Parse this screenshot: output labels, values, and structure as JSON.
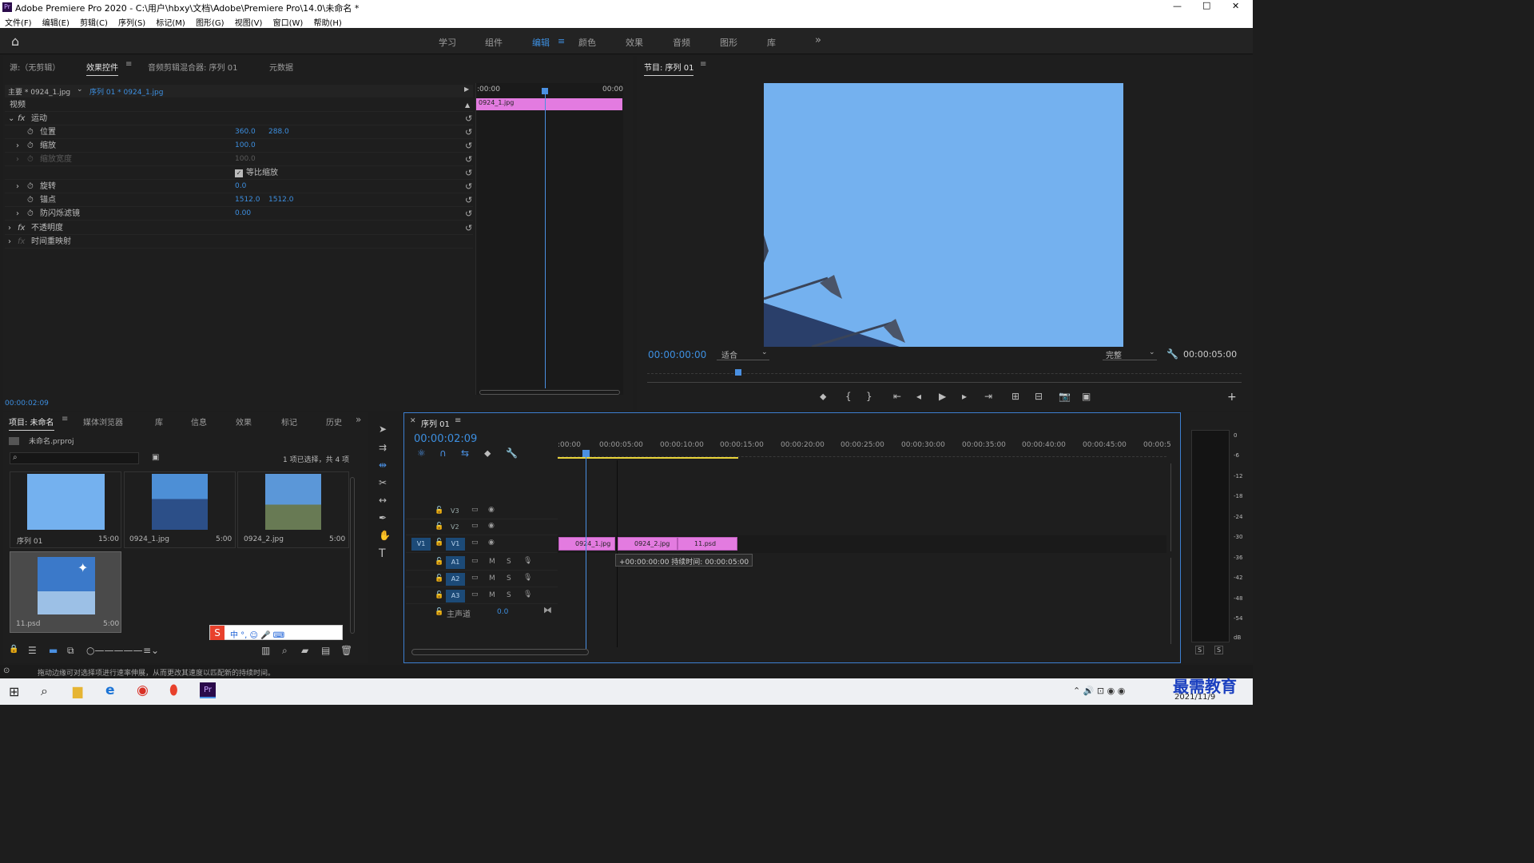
{
  "window": {
    "title": "Adobe Premiere Pro 2020 - C:\\用户\\hbxy\\文档\\Adobe\\Premiere Pro\\14.0\\未命名 *",
    "minimize": "—",
    "maximize": "□",
    "close": "✕"
  },
  "menu": [
    "文件(F)",
    "编辑(E)",
    "剪辑(C)",
    "序列(S)",
    "标记(M)",
    "图形(G)",
    "视图(V)",
    "窗口(W)",
    "帮助(H)"
  ],
  "workspaces": [
    "学习",
    "组件",
    "编辑",
    "颜色",
    "效果",
    "音频",
    "图形",
    "库"
  ],
  "workspaces_more": "»",
  "source_tabs": {
    "source": "源:（无剪辑）",
    "effect_controls": "效果控件",
    "audio_mixer": "音频剪辑混合器: 序列 01",
    "metadata": "元数据"
  },
  "effect_controls": {
    "master": "主要 * 0924_1.jpg",
    "sequence": "序列 01 * 0924_1.jpg",
    "time_start": ":00:00",
    "time_end": "00:00",
    "clip": "0924_1.jpg",
    "section_video": "视频",
    "motion": "运动",
    "position": "位置",
    "position_x": "360.0",
    "position_y": "288.0",
    "scale": "缩放",
    "scale_val": "100.0",
    "scale_width": "缩放宽度",
    "scale_width_val": "100.0",
    "uniform_scale": "等比缩放",
    "rotation": "旋转",
    "rotation_val": "0.0",
    "anchor": "锚点",
    "anchor_x": "1512.0",
    "anchor_y": "1512.0",
    "antiflicker": "防闪烁滤镜",
    "antiflicker_val": "0.00",
    "opacity": "不透明度",
    "time_remap": "时间重映射",
    "current_time": "00:00:02:09"
  },
  "program": {
    "title": "节目: 序列 01",
    "timecode": "00:00:00:00",
    "fit": "适合",
    "quality": "完整",
    "duration": "00:00:05:00"
  },
  "project": {
    "tabs": [
      "项目: 未命名",
      "媒体浏览器",
      "库",
      "信息",
      "效果",
      "标记",
      "历史"
    ],
    "file": "未命名.prproj",
    "selection": "1 项已选择，共 4 项",
    "items": [
      {
        "name": "序列 01",
        "dur": "15:00"
      },
      {
        "name": "0924_1.jpg",
        "dur": "5:00"
      },
      {
        "name": "0924_2.jpg",
        "dur": "5:00"
      },
      {
        "name": "11.psd",
        "dur": "5:00"
      }
    ]
  },
  "ime": "中 °, ☺ 🎤 ⌨",
  "timeline": {
    "tab": "序列 01",
    "timecode": "00:00:02:09",
    "ruler": [
      ":00:00",
      "00:00:05:00",
      "00:00:10:00",
      "00:00:15:00",
      "00:00:20:00",
      "00:00:25:00",
      "00:00:30:00",
      "00:00:35:00",
      "00:00:40:00",
      "00:00:45:00",
      "00:00:5"
    ],
    "tracks": [
      "V3",
      "V2",
      "V1",
      "A1",
      "A2",
      "A3"
    ],
    "v1_source": "V1",
    "master": "主声道",
    "master_val": "0.0",
    "m": "M",
    "s": "S",
    "clips": [
      "0924_1.jpg",
      "0924_2.jpg",
      "11.psd"
    ],
    "tooltip": "+00:00:00:00 持续时间: 00:00:05:00"
  },
  "meter": [
    "0",
    "-6",
    "-12",
    "-18",
    "-24",
    "-30",
    "-36",
    "-42",
    "-48",
    "-54",
    "dB"
  ],
  "meter_solo": "S",
  "status": "拖动边缘可对选择项进行速率伸展，从而更改其速度以匹配新的持续时间。",
  "taskbar": {
    "date": "2021/11/9",
    "watermark": "最需教育"
  }
}
